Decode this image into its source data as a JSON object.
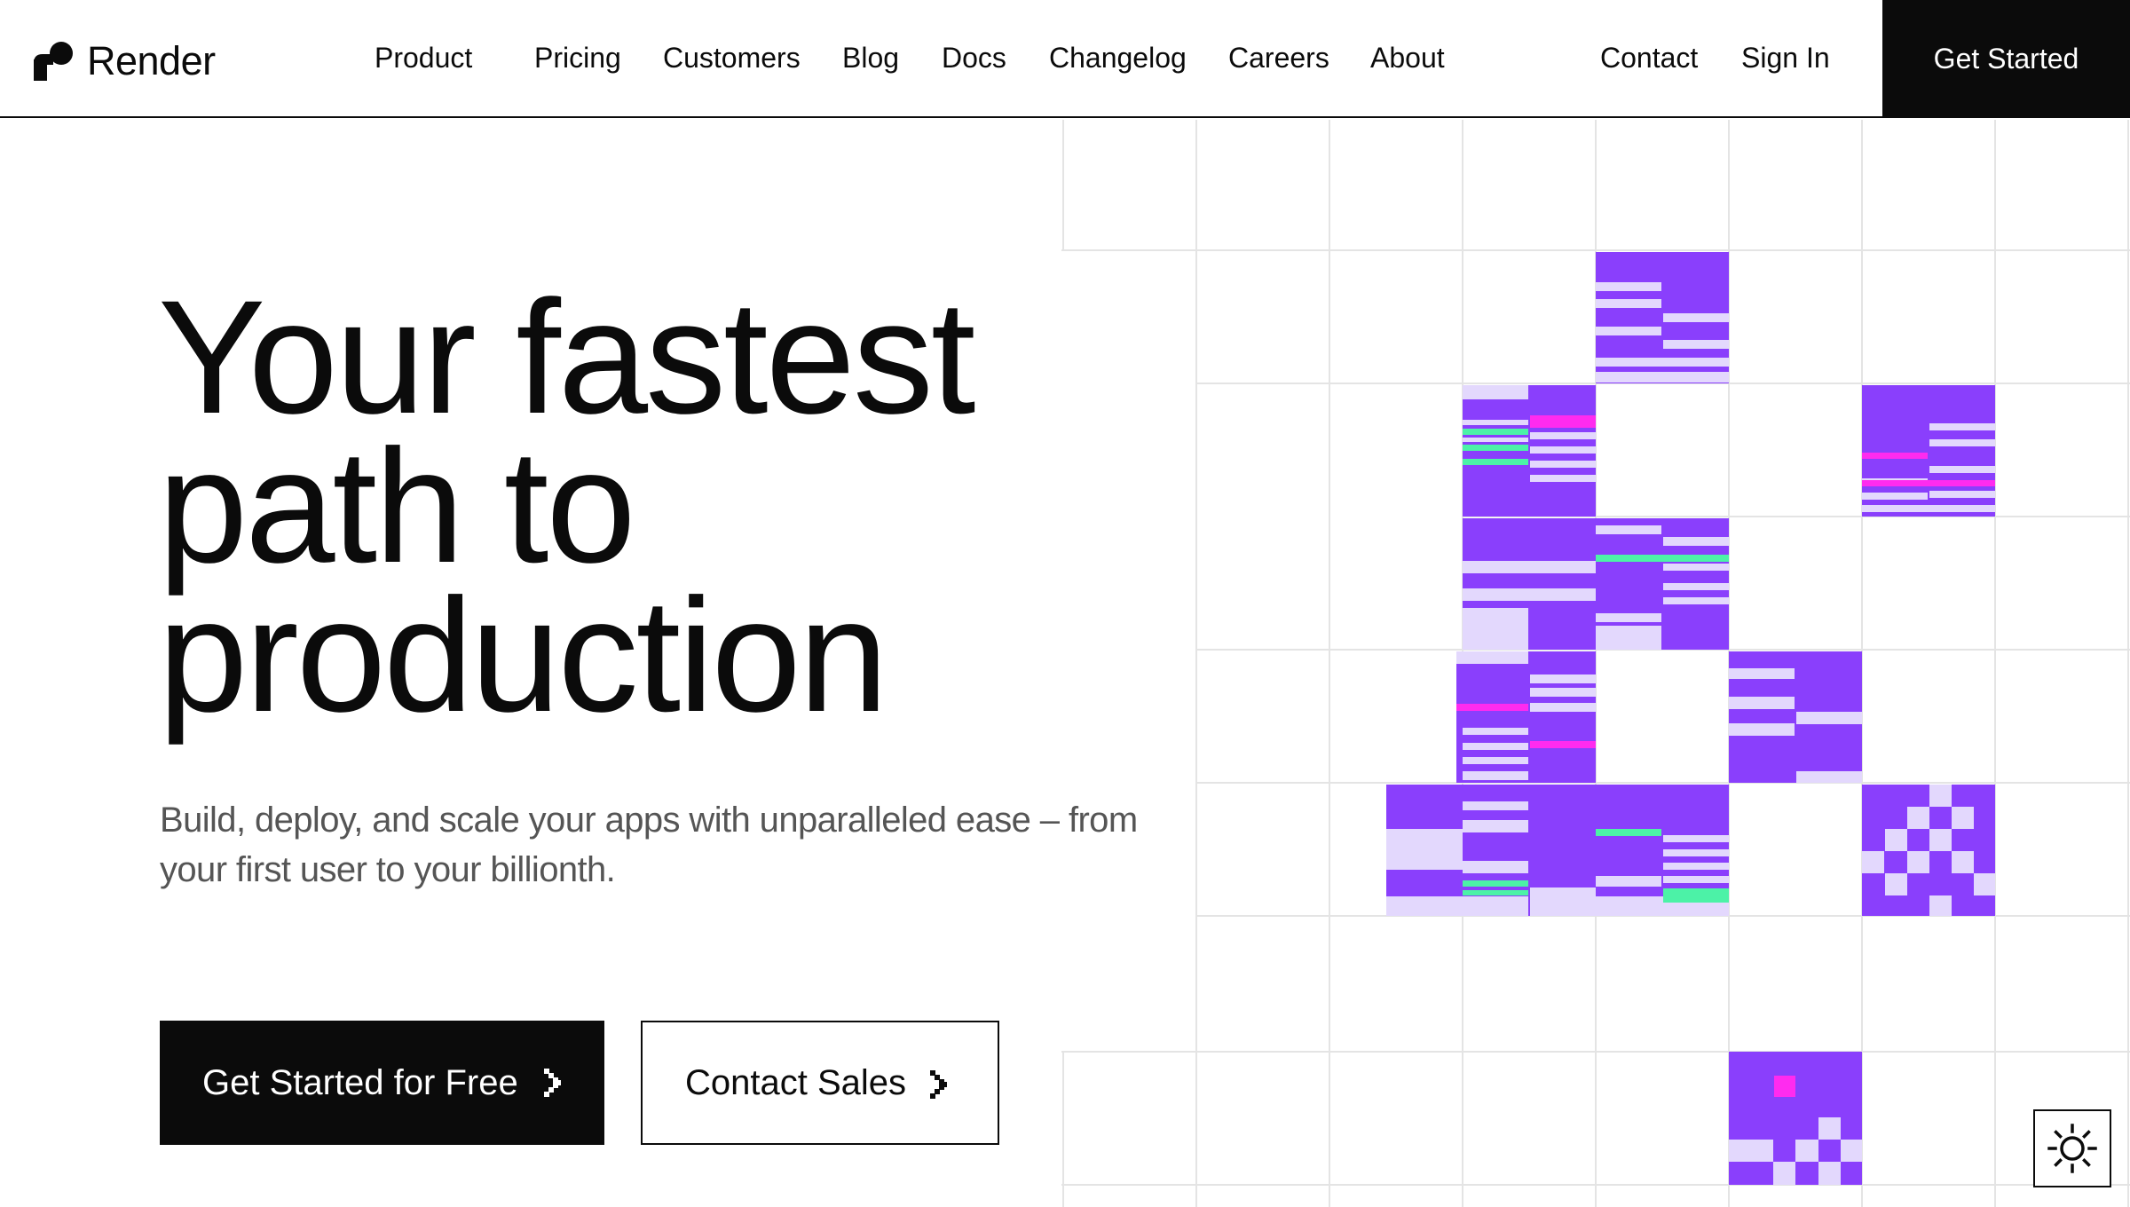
{
  "brand": {
    "name": "Render",
    "accent": "#8a3ffc",
    "accent_light": "#e3d8fd",
    "magenta": "#ff2bef",
    "mint": "#4cf2a7",
    "ink": "#0b0b0b"
  },
  "nav": {
    "primary": [
      "Product",
      "Pricing",
      "Customers",
      "Blog",
      "Docs",
      "Changelog",
      "Careers",
      "About"
    ],
    "contact": "Contact",
    "sign_in": "Sign In",
    "cta": "Get Started"
  },
  "hero": {
    "headline_lines": [
      "Your fastest",
      "path to",
      "production"
    ],
    "subtitle": "Build, deploy, and scale your apps with unparalleled ease – from your first user to your billionth.",
    "primary_cta": "Get Started for Free",
    "secondary_cta": "Contact Sales"
  },
  "icons": {
    "logo": "render-logo-icon",
    "button_arrow": "chevron-right-icon",
    "theme": "sun-icon"
  }
}
